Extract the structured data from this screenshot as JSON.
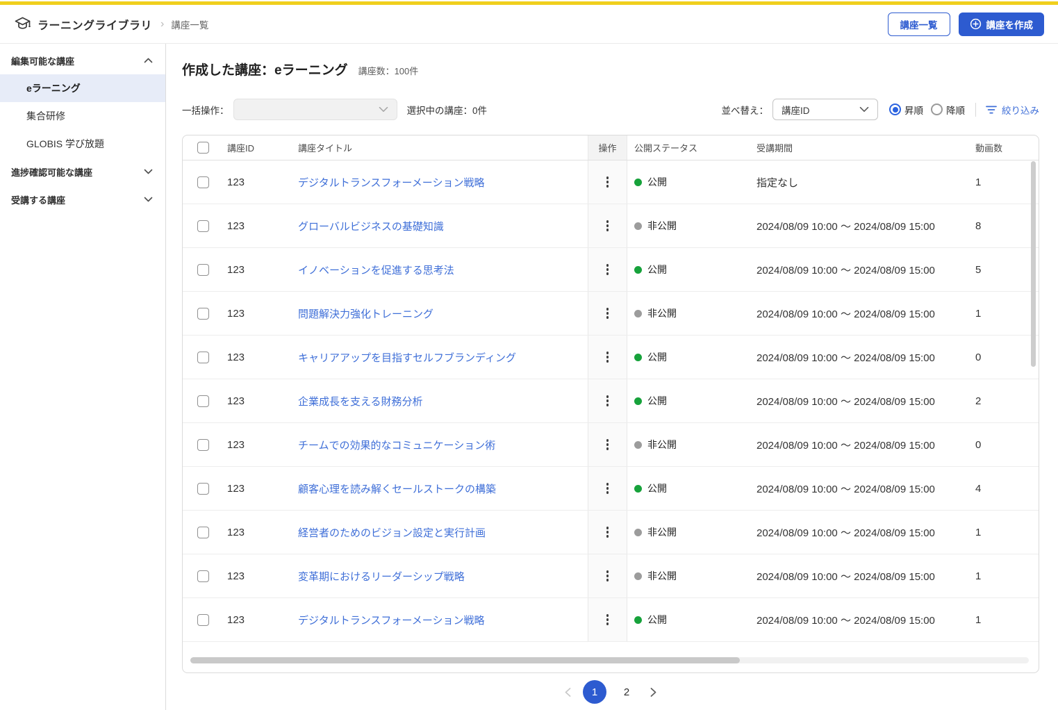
{
  "colors": {
    "accent_blue": "#2d5bd0",
    "brand_yellow": "#f0cf1d",
    "status_public": "#17a23b",
    "status_private": "#9c9c9c",
    "link_blue": "#3f6fd8",
    "sidebar_active_bg": "#e7ecf8"
  },
  "header": {
    "brand": "ラーニングライブラリ",
    "breadcrumb": "講座一覧",
    "list_button": "講座一覧",
    "create_button": "講座を作成"
  },
  "sidebar": {
    "sections": [
      {
        "label": "編集可能な講座",
        "expanded": true
      },
      {
        "label": "進捗確認可能な講座",
        "expanded": false
      },
      {
        "label": "受講する講座",
        "expanded": false
      }
    ],
    "items": [
      {
        "label": "eラーニング",
        "active": true
      },
      {
        "label": "集合研修",
        "active": false
      },
      {
        "label": "GLOBIS 学び放題",
        "active": false
      }
    ]
  },
  "main": {
    "title": "作成した講座：eラーニング",
    "count": "講座数：100件"
  },
  "toolbar": {
    "bulk_label": "一括操作：",
    "bulk_value": "",
    "selected_info": "選択中の講座：0件",
    "sort_label": "並べ替え：",
    "sort_value": "講座ID",
    "asc_label": "昇順",
    "desc_label": "降順",
    "sort_order": "昇順",
    "filter_label": "絞り込み"
  },
  "table": {
    "columns": [
      "講座ID",
      "講座タイトル",
      "操作",
      "公開ステータス",
      "受講期間",
      "動画数"
    ],
    "rows": [
      {
        "id": "123",
        "title": "デジタルトランスフォーメーション戦略",
        "status": "公開",
        "status_type": "public",
        "period": "指定なし",
        "videos": "1"
      },
      {
        "id": "123",
        "title": "グローバルビジネスの基礎知識",
        "status": "非公開",
        "status_type": "private",
        "period": "2024/08/09 10:00 ～ 2024/08/09 15:00",
        "videos": "8"
      },
      {
        "id": "123",
        "title": "イノベーションを促進する思考法",
        "status": "公開",
        "status_type": "public",
        "period": "2024/08/09 10:00 ～ 2024/08/09 15:00",
        "videos": "5"
      },
      {
        "id": "123",
        "title": "問題解決力強化トレーニング",
        "status": "非公開",
        "status_type": "private",
        "period": "2024/08/09 10:00 ～ 2024/08/09 15:00",
        "videos": "1"
      },
      {
        "id": "123",
        "title": "キャリアアップを目指すセルフブランディング",
        "status": "公開",
        "status_type": "public",
        "period": "2024/08/09 10:00 ～ 2024/08/09 15:00",
        "videos": "0"
      },
      {
        "id": "123",
        "title": "企業成長を支える財務分析",
        "status": "公開",
        "status_type": "public",
        "period": "2024/08/09 10:00 ～ 2024/08/09 15:00",
        "videos": "2"
      },
      {
        "id": "123",
        "title": "チームでの効果的なコミュニケーション術",
        "status": "非公開",
        "status_type": "private",
        "period": "2024/08/09 10:00 ～ 2024/08/09 15:00",
        "videos": "0"
      },
      {
        "id": "123",
        "title": "顧客心理を読み解くセールストークの構築",
        "status": "公開",
        "status_type": "public",
        "period": "2024/08/09 10:00 ～ 2024/08/09 15:00",
        "videos": "4"
      },
      {
        "id": "123",
        "title": "経営者のためのビジョン設定と実行計画",
        "status": "非公開",
        "status_type": "private",
        "period": "2024/08/09 10:00 ～ 2024/08/09 15:00",
        "videos": "1"
      },
      {
        "id": "123",
        "title": "変革期におけるリーダーシップ戦略",
        "status": "非公開",
        "status_type": "private",
        "period": "2024/08/09 10:00 ～ 2024/08/09 15:00",
        "videos": "1"
      },
      {
        "id": "123",
        "title": "デジタルトランスフォーメーション戦略",
        "status": "公開",
        "status_type": "public",
        "period": "2024/08/09 10:00 ～ 2024/08/09 15:00",
        "videos": "1"
      }
    ]
  },
  "pagination": {
    "pages": [
      "1",
      "2"
    ],
    "current": "1"
  }
}
